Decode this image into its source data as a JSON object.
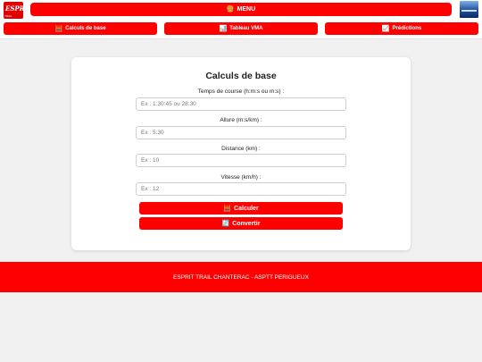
{
  "header": {
    "menu_label": "MENU",
    "menu_icon": "hamburger-emoji-icon",
    "logo_left_text": "ESPRIT",
    "logo_left_sub": "TRAIL",
    "nav": [
      {
        "label": "Calculs de base",
        "icon": "abacus-icon"
      },
      {
        "label": "Tableau VMA",
        "icon": "bar-chart-icon"
      },
      {
        "label": "Prédictions",
        "icon": "trend-chart-icon"
      }
    ]
  },
  "form": {
    "title": "Calculs de base",
    "fields": [
      {
        "label": "Temps de course (h:m:s ou m:s) :",
        "placeholder": "Ex : 1:30:45 ou 28:30",
        "value": ""
      },
      {
        "label": "Allure (m:s/km) :",
        "placeholder": "Ex : 5:30",
        "value": ""
      },
      {
        "label": "Distance (km) :",
        "placeholder": "Ex : 10",
        "value": ""
      },
      {
        "label": "Vitesse (km/h) :",
        "placeholder": "Ex : 12",
        "value": ""
      }
    ],
    "calculate_label": "Calculer",
    "convert_label": "Convertir"
  },
  "footer": {
    "text": "ESPRIT TRAIL CHANTERAC - ASPTT PERIGUEUX"
  },
  "colors": {
    "accent": "#fe0000",
    "background": "#f1f1f1",
    "card": "#ffffff"
  }
}
